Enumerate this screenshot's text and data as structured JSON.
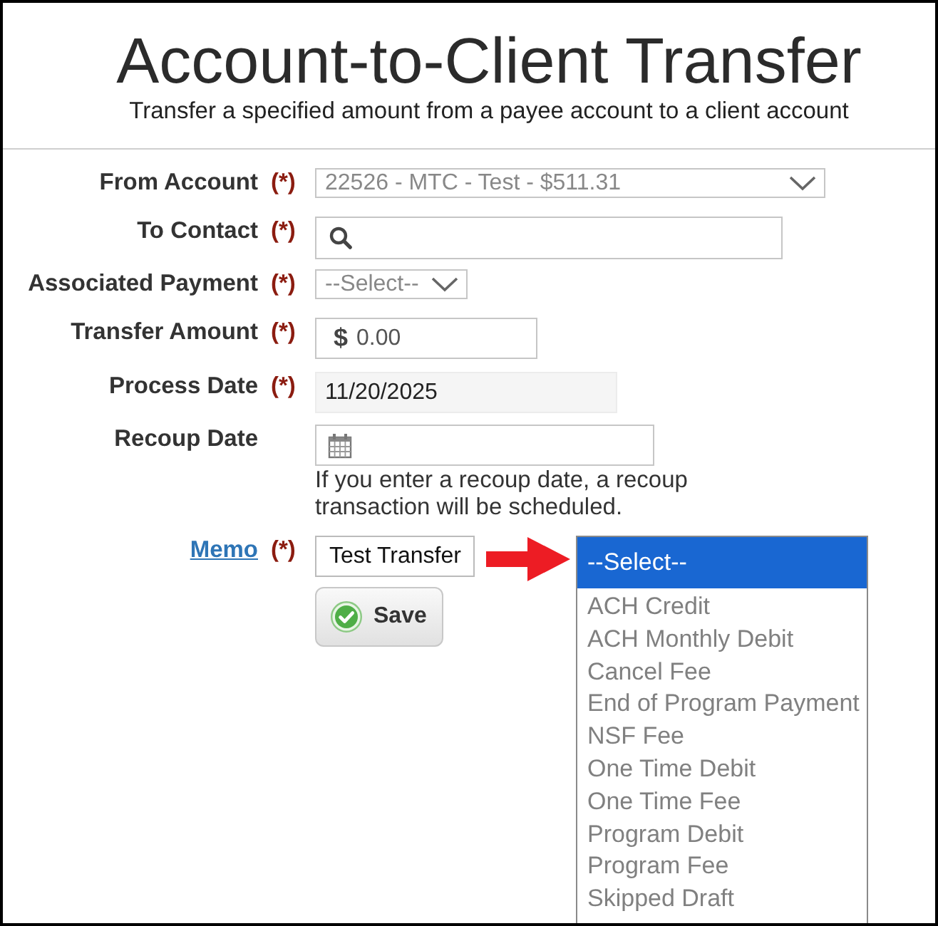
{
  "header": {
    "title": "Account-to-Client Transfer",
    "subtitle": "Transfer a specified amount from a payee account to a client account"
  },
  "form": {
    "fields": [
      {
        "kind": "select",
        "label": "From Account",
        "link": false,
        "required_mark": "(*)",
        "value": "22526 - MTC - Test - $511.31"
      },
      {
        "kind": "search",
        "label": "To Contact",
        "link": false,
        "required_mark": "(*)"
      },
      {
        "kind": "select",
        "label": "Associated Payment",
        "link": false,
        "required_mark": "(*)",
        "value": "--Select--"
      },
      {
        "kind": "currency",
        "label": "Transfer Amount",
        "link": false,
        "required_mark": "(*)",
        "symbol": "$",
        "value": "0.00"
      },
      {
        "kind": "readonly",
        "label": "Process Date",
        "link": false,
        "required_mark": "(*)",
        "value": "11/20/2025"
      },
      {
        "kind": "date",
        "label": "Recoup Date",
        "link": false,
        "hint": "If you enter a recoup date, a recoup transaction will be scheduled."
      },
      {
        "kind": "text",
        "label": "Memo",
        "link": true,
        "required_mark": "(*)",
        "value": "Test Transfer"
      }
    ],
    "save_button": {
      "label": "Save"
    }
  },
  "dropdown_list": {
    "options": [
      {
        "label": "--Select--",
        "selected": true
      },
      {
        "label": "ACH Credit",
        "selected": false
      },
      {
        "label": "ACH Monthly Debit",
        "selected": false
      },
      {
        "label": "Cancel Fee",
        "selected": false
      },
      {
        "label": "End of Program Payment",
        "selected": false
      },
      {
        "label": "NSF Fee",
        "selected": false
      },
      {
        "label": "One Time Debit",
        "selected": false
      },
      {
        "label": "One Time Fee",
        "selected": false
      },
      {
        "label": "Program Debit",
        "selected": false
      },
      {
        "label": "Program Fee",
        "selected": false
      },
      {
        "label": "Skipped Draft",
        "selected": false
      }
    ]
  }
}
